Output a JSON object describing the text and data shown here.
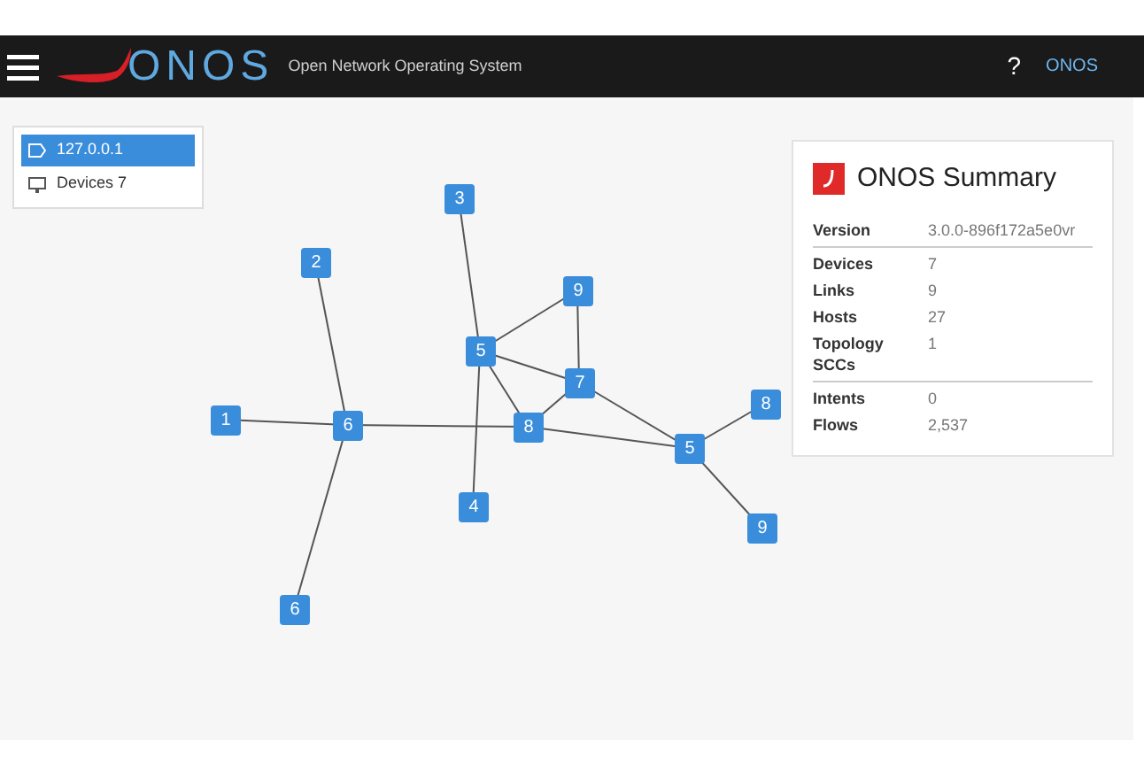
{
  "header": {
    "logo_text": "ONOS",
    "subtitle": "Open Network Operating System",
    "help": "?",
    "user": "ONOS"
  },
  "instance_panel": {
    "items": [
      {
        "kind": "instance",
        "label": "127.0.0.1",
        "selected": true
      },
      {
        "kind": "devices",
        "label": "Devices 7",
        "selected": false
      }
    ]
  },
  "summary": {
    "title": "ONOS Summary",
    "sections": [
      [
        {
          "label": "Version",
          "value": "3.0.0-896f172a5e0vr"
        }
      ],
      [
        {
          "label": "Devices",
          "value": "7"
        },
        {
          "label": "Links",
          "value": "9"
        },
        {
          "label": "Hosts",
          "value": "27"
        },
        {
          "label": "Topology SCCs",
          "value": "1"
        }
      ],
      [
        {
          "label": "Intents",
          "value": "0"
        },
        {
          "label": "Flows",
          "value": "2,537"
        }
      ]
    ]
  },
  "topology": {
    "nodes": [
      {
        "label": "3"
      },
      {
        "label": "2"
      },
      {
        "label": "9"
      },
      {
        "label": "5"
      },
      {
        "label": "7"
      },
      {
        "label": "8"
      },
      {
        "label": "1"
      },
      {
        "label": "6"
      },
      {
        "label": "4"
      },
      {
        "label": "6"
      },
      {
        "label": "5"
      },
      {
        "label": "8"
      },
      {
        "label": "9"
      }
    ]
  }
}
